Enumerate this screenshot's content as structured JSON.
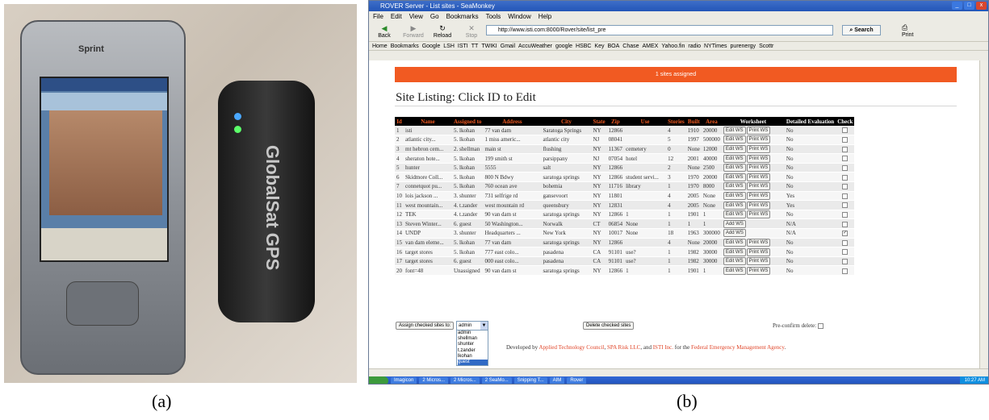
{
  "captions": {
    "a": "(a)",
    "b": "(b)"
  },
  "device": {
    "phone_brand": "Sprint",
    "gps_label": "GlobalSat GPS"
  },
  "browser": {
    "title": "ROVER Server - List sites - SeaMonkey",
    "menu": [
      "File",
      "Edit",
      "View",
      "Go",
      "Bookmarks",
      "Tools",
      "Window",
      "Help"
    ],
    "nav": {
      "back": "Back",
      "forward": "Forward",
      "reload": "Reload",
      "stop": "Stop",
      "search": "Search",
      "print": "Print"
    },
    "url": "http://www.isti.com:8000/Rover/site/list_pre",
    "bookmarks": [
      "Home",
      "Bookmarks",
      "Google",
      "LSH",
      "ISTI",
      "TT",
      "TWIKI",
      "Gmail",
      "AccuWeather",
      "google",
      "HSBC",
      "Key",
      "BOA",
      "Chase",
      "AMEX",
      "Yahoo.fin",
      "radio",
      "NYTimes",
      "purenergy",
      "Scottr"
    ]
  },
  "page": {
    "banner": "1 sites assigned",
    "heading": "Site Listing: Click ID to Edit",
    "columns": [
      "Id",
      "Name",
      "Assigned to",
      "Address",
      "City",
      "State",
      "Zip",
      "Use",
      "Stories",
      "Built",
      "Area",
      "Worksheet",
      "Detailed Evaluation",
      "Check"
    ],
    "rows": [
      {
        "id": "1",
        "name": "isti",
        "assigned": "5. lkohan",
        "address": "77 van dam",
        "city": "Saratoga Springs",
        "state": "NY",
        "zip": "12866",
        "use": "",
        "stories": "4",
        "built": "1910",
        "area": "20000",
        "ws": [
          "Edit WS",
          "Print WS"
        ],
        "detailed": "No",
        "checked": false
      },
      {
        "id": "2",
        "name": "atlantic city...",
        "assigned": "5. lkohan",
        "address": "1 miss americ...",
        "city": "atlantic city",
        "state": "NJ",
        "zip": "08041",
        "use": "",
        "stories": "5",
        "built": "1997",
        "area": "500000",
        "ws": [
          "Edit WS",
          "Print WS"
        ],
        "detailed": "No",
        "checked": false
      },
      {
        "id": "3",
        "name": "mt hebron cem...",
        "assigned": "2. shellman",
        "address": "main st",
        "city": "flushing",
        "state": "NY",
        "zip": "11367",
        "use": "cemetery",
        "stories": "0",
        "built": "None",
        "area": "12000",
        "ws": [
          "Edit WS",
          "Print WS"
        ],
        "detailed": "No",
        "checked": false
      },
      {
        "id": "4",
        "name": "sheraton hote...",
        "assigned": "5. lkohan",
        "address": "199 smith st",
        "city": "parsippany",
        "state": "NJ",
        "zip": "07054",
        "use": "hotel",
        "stories": "12",
        "built": "2001",
        "area": "40000",
        "ws": [
          "Edit WS",
          "Print WS"
        ],
        "detailed": "No",
        "checked": false
      },
      {
        "id": "5",
        "name": "hunter",
        "assigned": "5. lkohan",
        "address": "5555",
        "city": "salt",
        "state": "NY",
        "zip": "12866",
        "use": "",
        "stories": "2",
        "built": "None",
        "area": "2500",
        "ws": [
          "Edit WS",
          "Print WS"
        ],
        "detailed": "No",
        "checked": false
      },
      {
        "id": "6",
        "name": "Skidmore Coll...",
        "assigned": "5. lkohan",
        "address": "800 N Bdwy",
        "city": "saratoga springs",
        "state": "NY",
        "zip": "12866",
        "use": "student servi...",
        "stories": "3",
        "built": "1970",
        "area": "20000",
        "ws": [
          "Edit WS",
          "Print WS"
        ],
        "detailed": "No",
        "checked": false
      },
      {
        "id": "7",
        "name": "connetquot pu...",
        "assigned": "5. lkohan",
        "address": "760 ocean ave",
        "city": "bohemia",
        "state": "NY",
        "zip": "11716",
        "use": "library",
        "stories": "1",
        "built": "1970",
        "area": "8000",
        "ws": [
          "Edit WS",
          "Print WS"
        ],
        "detailed": "No",
        "checked": false
      },
      {
        "id": "10",
        "name": "lois jackson ...",
        "assigned": "3. shunter",
        "address": "731 selfrige rd",
        "city": "gansevoort",
        "state": "NY",
        "zip": "11801",
        "use": "",
        "stories": "4",
        "built": "2005",
        "area": "None",
        "ws": [
          "Edit WS",
          "Print WS"
        ],
        "detailed": "Yes",
        "checked": false
      },
      {
        "id": "11",
        "name": "west mountain...",
        "assigned": "4. t.zander",
        "address": "west mountain rd",
        "city": "queensbury",
        "state": "NY",
        "zip": "12831",
        "use": "",
        "stories": "4",
        "built": "2005",
        "area": "None",
        "ws": [
          "Edit WS",
          "Print WS"
        ],
        "detailed": "Yes",
        "checked": false
      },
      {
        "id": "12",
        "name": "TEK",
        "assigned": "4. t.zander",
        "address": "90 van dam st",
        "city": "saratoga springs",
        "state": "NY",
        "zip": "12866",
        "use": "1",
        "stories": "1",
        "built": "1901",
        "area": "1",
        "ws": [
          "Edit WS",
          "Print WS"
        ],
        "detailed": "No",
        "checked": false
      },
      {
        "id": "13",
        "name": "Steven Winter...",
        "assigned": "6. guest",
        "address": "50 Washington...",
        "city": "Norwalk",
        "state": "CT",
        "zip": "06854",
        "use": "None",
        "stories": "1",
        "built": "1",
        "area": "1",
        "ws": [
          "Add WS"
        ],
        "detailed": "N/A",
        "checked": false
      },
      {
        "id": "14",
        "name": "UNDP",
        "assigned": "3. shunter",
        "address": "Headquarters ...",
        "city": "New York",
        "state": "NY",
        "zip": "10017",
        "use": "None",
        "stories": "18",
        "built": "1963",
        "area": "300000",
        "ws": [
          "Add WS"
        ],
        "detailed": "N/A",
        "checked": true
      },
      {
        "id": "15",
        "name": "van dam eleme...",
        "assigned": "5. lkohan",
        "address": "77 van dam",
        "city": "saratoga springs",
        "state": "NY",
        "zip": "12866",
        "use": "",
        "stories": "4",
        "built": "None",
        "area": "20000",
        "ws": [
          "Edit WS",
          "Print WS"
        ],
        "detailed": "No",
        "checked": false
      },
      {
        "id": "16",
        "name": "target stores",
        "assigned": "5. lkohan",
        "address": "777 east colo...",
        "city": "pasadena",
        "state": "CA",
        "zip": "91101",
        "use": "use?",
        "stories": "1",
        "built": "1982",
        "area": "30000",
        "ws": [
          "Edit WS",
          "Print WS"
        ],
        "detailed": "No",
        "checked": false
      },
      {
        "id": "17",
        "name": "target stores",
        "assigned": "6. guest",
        "address": "000 east colo...",
        "city": "pasadena",
        "state": "CA",
        "zip": "91101",
        "use": "use?",
        "stories": "1",
        "built": "1982",
        "area": "30000",
        "ws": [
          "Edit WS",
          "Print WS"
        ],
        "detailed": "No",
        "checked": false
      },
      {
        "id": "20",
        "name": "font=48",
        "assigned": "Unassigned",
        "address": "90 van dam st",
        "city": "saratoga springs",
        "state": "NY",
        "zip": "12866",
        "use": "1",
        "stories": "1",
        "built": "1901",
        "area": "1",
        "ws": [
          "Edit WS",
          "Print WS"
        ],
        "detailed": "No",
        "checked": false
      }
    ],
    "assign_button": "Assign checked sites to:",
    "assign_selected": "admin",
    "assign_options": [
      "admin",
      "shellman",
      "shunter",
      "t.zander",
      "lkohan",
      "guest"
    ],
    "delete_button": "Delete checked sites",
    "preconfirm_label": "Pre-confirm delete:",
    "footer": {
      "prefix": "Developed by ",
      "org1": "Applied Technology Council",
      "sep1": ", ",
      "org2": "SPA Risk LLC",
      "sep2": ", and ",
      "org3": "ISTI Inc.",
      "mid": " for the ",
      "org4": "Federal Emergency Management Agency",
      "suffix": "."
    }
  },
  "taskbar": {
    "tasks": [
      "Imagicon",
      "2 Micros...",
      "2 Micros...",
      "2 SeaMo...",
      "Snipping T...",
      "AIM",
      "Rover"
    ],
    "clock": "10:27 AM"
  }
}
